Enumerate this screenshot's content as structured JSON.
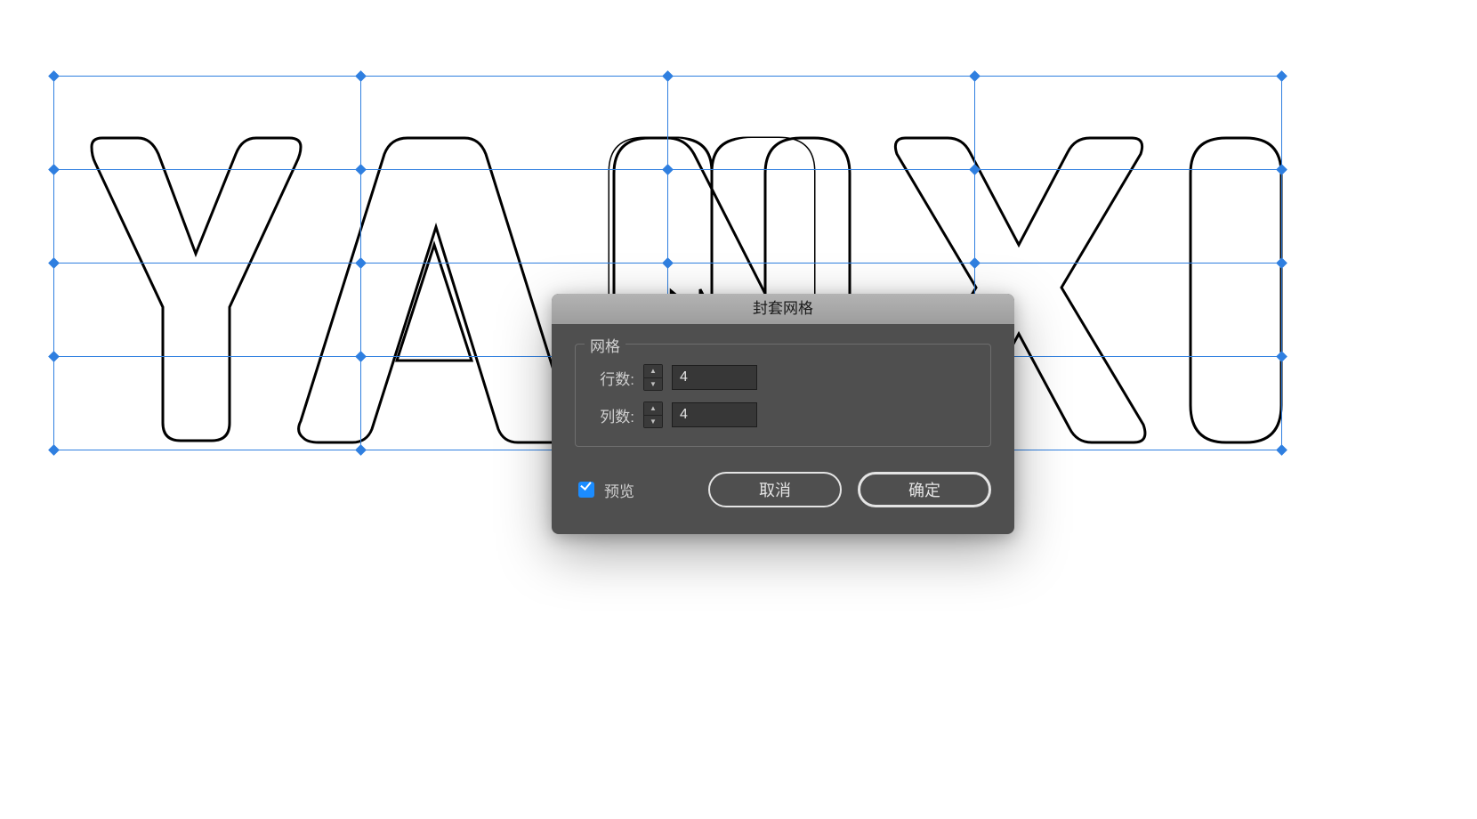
{
  "dialog": {
    "title": "封套网格",
    "group_label": "网格",
    "rows_label": "行数:",
    "rows_value": "4",
    "cols_label": "列数:",
    "cols_value": "4",
    "preview_label": "预览",
    "preview_checked": true,
    "cancel_label": "取消",
    "ok_label": "确定"
  },
  "canvas": {
    "artwork_text": "YANXI",
    "mesh": {
      "rows": 4,
      "cols": 4
    },
    "colors": {
      "mesh": "#2f7fe0",
      "outline": "#000000"
    }
  }
}
